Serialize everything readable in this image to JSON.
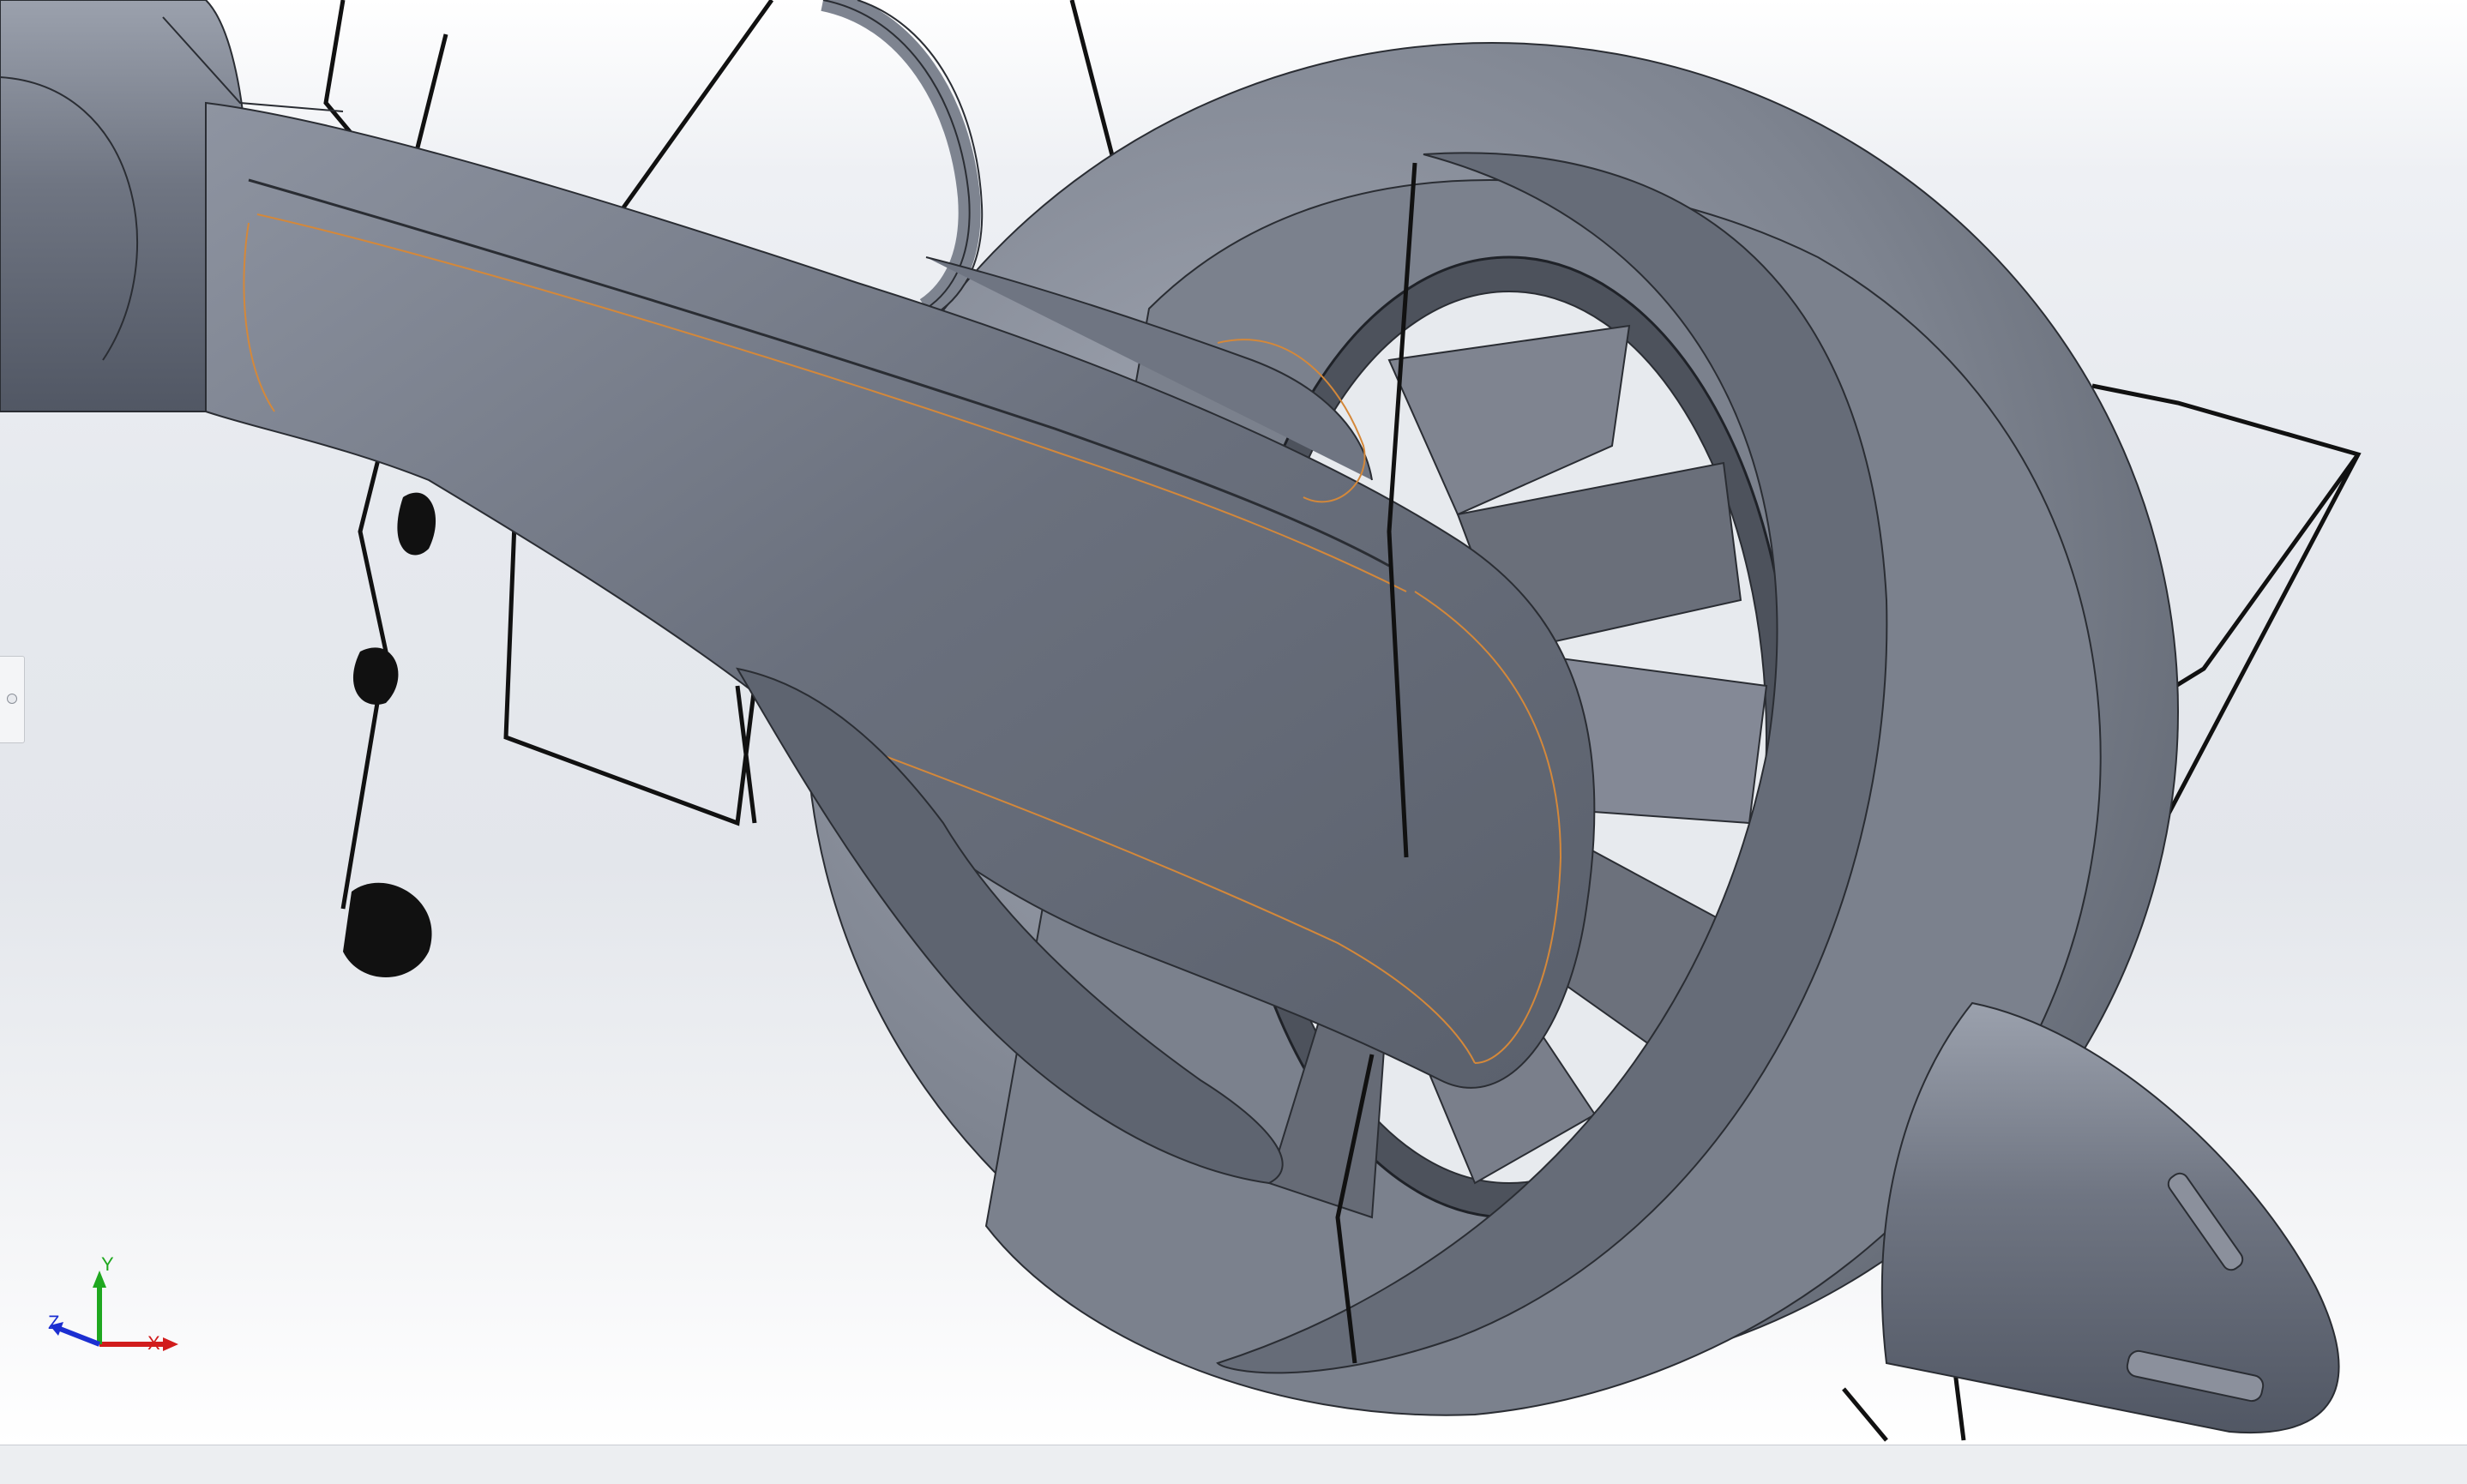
{
  "view": {
    "triad": {
      "x_label": "X",
      "y_label": "Y",
      "z_label": "Z"
    },
    "colors": {
      "model_body": "#7c8290",
      "model_shadow": "#545a66",
      "model_highlight": "#a9aebb",
      "edge": "#2a2d33",
      "selection": "#d4883a",
      "sketch": "#111111",
      "x_axis": "#d11c1c",
      "y_axis": "#1fa81f",
      "z_axis": "#1c2fd1"
    }
  },
  "icons": {
    "side_tab": "panel-expand-icon",
    "triad": "axis-triad-icon"
  }
}
